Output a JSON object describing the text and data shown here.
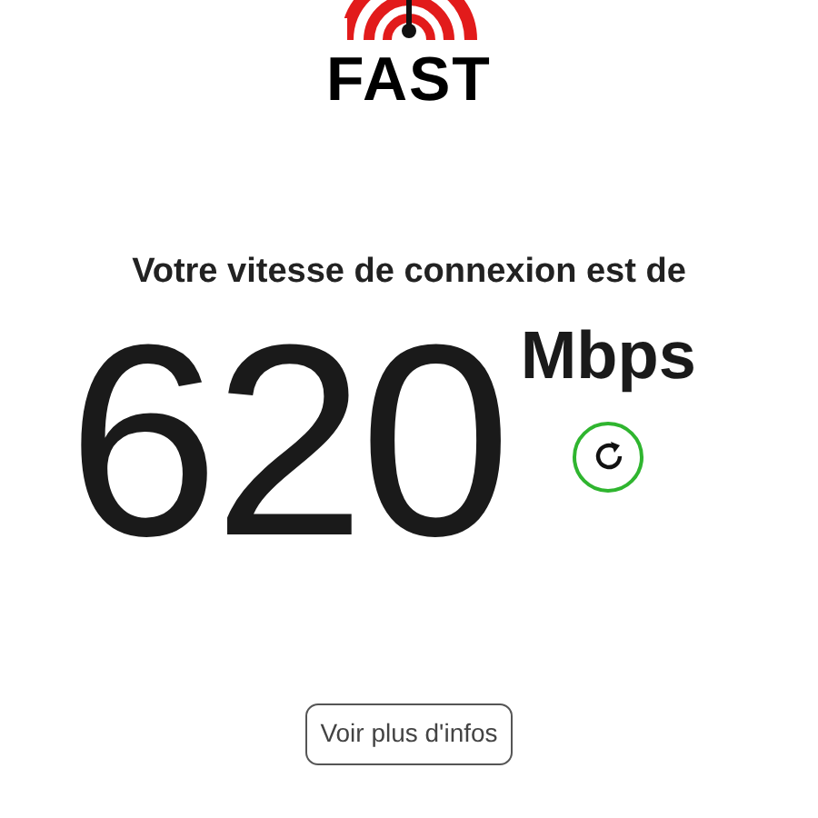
{
  "logo": {
    "text": "FAST"
  },
  "headline": "Votre vitesse de connexion est de",
  "speed": {
    "value": "620",
    "unit": "Mbps"
  },
  "more_button": {
    "label": "Voir plus d'infos"
  }
}
